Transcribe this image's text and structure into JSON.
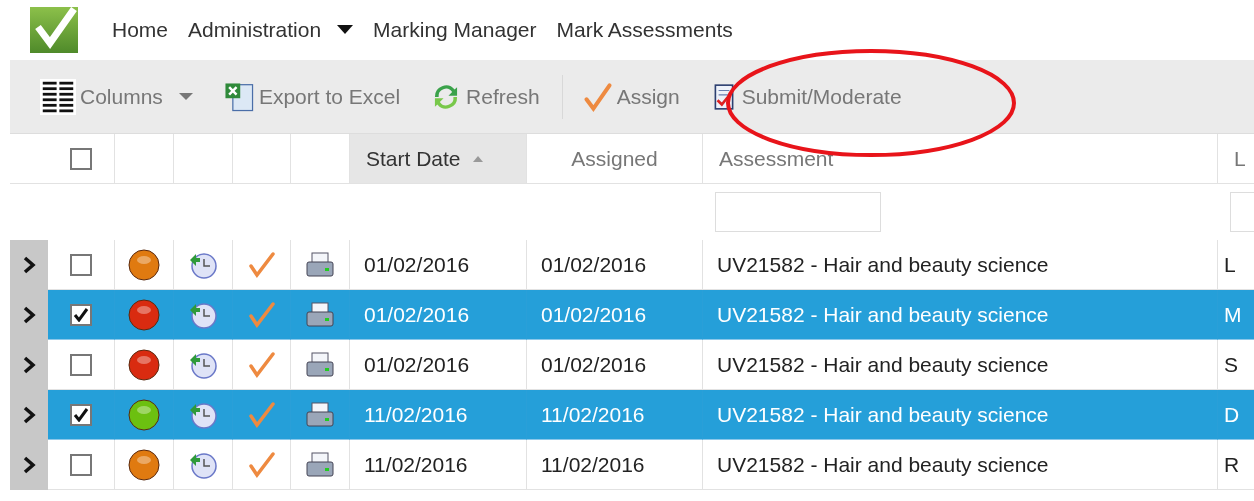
{
  "nav": {
    "items": [
      {
        "label": "Home",
        "dropdown": false
      },
      {
        "label": "Administration",
        "dropdown": true
      },
      {
        "label": "Marking Manager",
        "dropdown": false
      },
      {
        "label": "Mark Assessments",
        "dropdown": false
      }
    ]
  },
  "toolbar": {
    "buttons": [
      {
        "kind": "columns",
        "label": "Columns"
      },
      {
        "kind": "excel",
        "label": "Export to Excel"
      },
      {
        "kind": "refresh",
        "label": "Refresh"
      },
      {
        "kind": "assign",
        "label": "Assign"
      },
      {
        "kind": "submit",
        "label": "Submit/Moderate"
      }
    ]
  },
  "annotation": {
    "kind": "ellipse"
  },
  "table": {
    "select_all": {
      "checked": false
    },
    "columns": [
      {
        "label": "Start Date",
        "sorted": true
      },
      {
        "label": "Assigned",
        "sorted": false
      },
      {
        "label": "Assessment",
        "sorted": false
      },
      {
        "label": "L",
        "sorted": false
      }
    ],
    "rows": [
      {
        "selected": false,
        "checked": false,
        "color": "#e07a10",
        "start_date": "01/02/2016",
        "assigned": "01/02/2016",
        "assessment": "UV21582 - Hair and beauty science",
        "column_4": "L"
      },
      {
        "selected": true,
        "checked": true,
        "color": "#d92b10",
        "start_date": "01/02/2016",
        "assigned": "01/02/2016",
        "assessment": "UV21582 - Hair and beauty science",
        "column_4": "M"
      },
      {
        "selected": false,
        "checked": false,
        "color": "#d92b10",
        "start_date": "01/02/2016",
        "assigned": "01/02/2016",
        "assessment": "UV21582 - Hair and beauty science",
        "column_4": "S"
      },
      {
        "selected": true,
        "checked": true,
        "color": "#6cc010",
        "start_date": "11/02/2016",
        "assigned": "11/02/2016",
        "assessment": "UV21582 - Hair and beauty science",
        "column_4": "D"
      },
      {
        "selected": false,
        "checked": false,
        "color": "#e07a10",
        "start_date": "11/02/2016",
        "assigned": "11/02/2016",
        "assessment": "UV21582 - Hair and beauty science",
        "column_4": "R"
      }
    ]
  }
}
